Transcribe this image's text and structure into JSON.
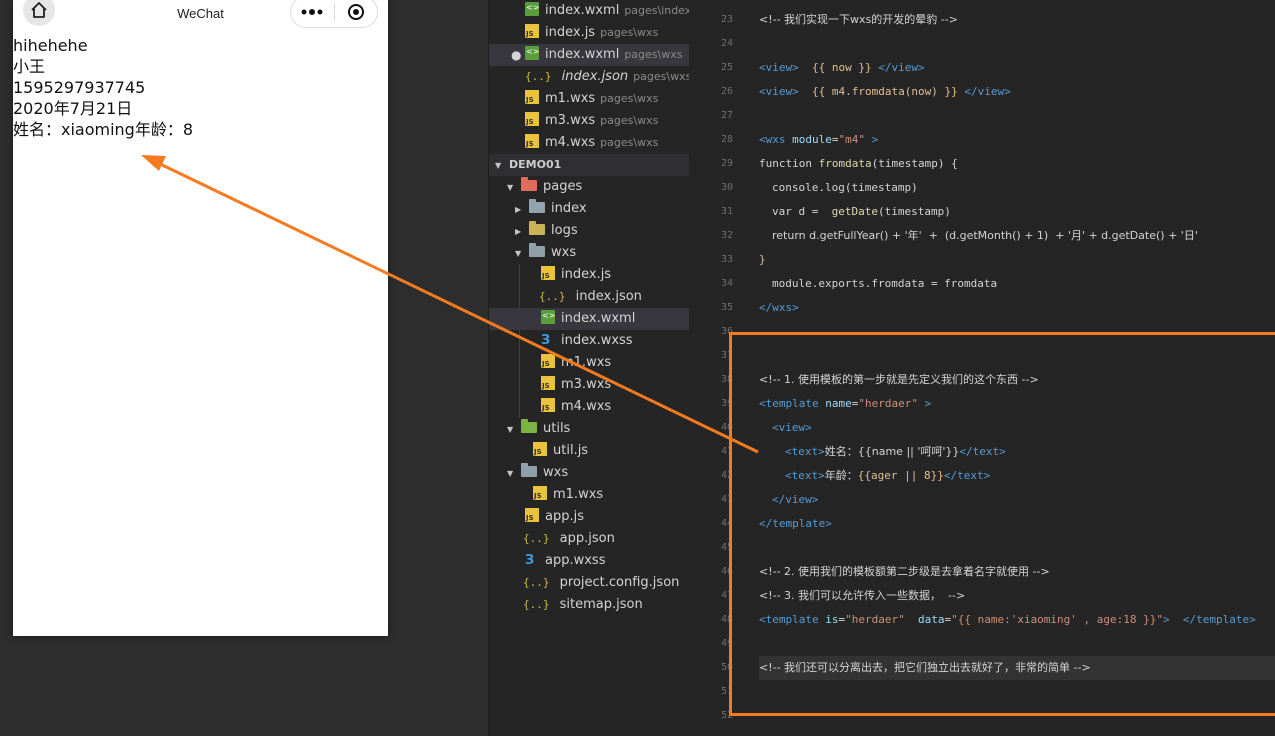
{
  "simulator": {
    "title": "WeChat",
    "lines": [
      "hihehehe",
      "小王",
      "1595297937745",
      "2020年7月21日",
      "姓名：xiaoming年龄：8"
    ]
  },
  "explorer": {
    "open_editors": [
      {
        "name": "index.wxml",
        "path": "pages\\index",
        "icon": "wxml"
      },
      {
        "name": "index.js",
        "path": "pages\\wxs",
        "icon": "js"
      },
      {
        "name": "index.wxml",
        "path": "pages\\wxs",
        "icon": "wxml",
        "modified": true
      },
      {
        "name": "index.json",
        "path": "pages\\wxs",
        "icon": "json",
        "italic": true
      },
      {
        "name": "m1.wxs",
        "path": "pages\\wxs",
        "icon": "js"
      },
      {
        "name": "m3.wxs",
        "path": "pages\\wxs",
        "icon": "js"
      },
      {
        "name": "m4.wxs",
        "path": "pages\\wxs",
        "icon": "js"
      }
    ],
    "project": "DEMO01",
    "tree": {
      "pages": "pages",
      "index": "index",
      "logs": "logs",
      "wxs": "wxs",
      "wxs_files": [
        "index.js",
        "index.json",
        "index.wxml",
        "index.wxss",
        "m1.wxs",
        "m3.wxs",
        "m4.wxs"
      ],
      "utils": "utils",
      "util_js": "util.js",
      "wxs2": "wxs",
      "m1": "m1.wxs",
      "root_files": [
        "app.js",
        "app.json",
        "app.wxss",
        "project.config.json",
        "sitemap.json"
      ]
    }
  },
  "editor": {
    "line_numbers": [
      "23",
      "24",
      "25",
      "26",
      "27",
      "28",
      "29",
      "30",
      "31",
      "32",
      "33",
      "34",
      "35",
      "36",
      "37",
      "38",
      "39",
      "40",
      "41",
      "42",
      "43",
      "44",
      "45",
      "46",
      "47",
      "48",
      "49",
      "50",
      "51",
      "52"
    ],
    "l23": "<!-- 我们实现一下wxs的开发的晕豹 -->",
    "l25a": "<view>",
    "l25b": "{{ now }}",
    "l25c": "</view>",
    "l26a": "<view>",
    "l26b": "{{ m4.fromdata(now) }}",
    "l26c": "</view>",
    "l28a": "<wxs",
    "l28b": "module",
    "l28c": "\"m4\"",
    "l28d": ">",
    "l29a": "function",
    "l29b": "fromdata",
    "l29c": "(timestamp) {",
    "l30": "console.log(timestamp)",
    "l31a": "var",
    "l31b": "d =",
    "l31c": "getDate",
    "l31d": "(timestamp)",
    "l32": "return d.getFullYear() + '年'  +  (d.getMonth() + 1)  + '月' + d.getDate() + '日'",
    "l33": "}",
    "l34": "module.exports.fromdata = fromdata",
    "l35": "</wxs>",
    "l38": "<!-- 1. 使用模板的第一步就是先定义我们的这个东西 -->",
    "l39a": "<template",
    "l39b": "name",
    "l39c": "\"herdaer\"",
    "l39d": ">",
    "l40": "<view>",
    "l41a": "<text>",
    "l41b": "姓名：",
    "l41c": "{{name || '呵呵'}}",
    "l41d": "</text>",
    "l42a": "<text>",
    "l42b": "年龄：",
    "l42c": "{{ager || 8}}",
    "l42d": "</text>",
    "l43": "</view>",
    "l44": "</template>",
    "l47": "<!-- 2. 使用我们的模板额第二步级是去拿着名字就使用 -->",
    "l48": "<!-- 3. 我们可以允许传入一些数据，  -->",
    "l49a": "<template",
    "l49b": "is",
    "l49c": "\"herdaer\"",
    "l49d": "data",
    "l49e": "\"{{ name:'xiaoming' , age:18 }}\"",
    "l49f": ">",
    "l49g": "</template>",
    "l51": "<!-- 我们还可以分离出去，把它们独立出去就好了，非常的简单 -->"
  },
  "colors": {
    "annotation": "#f47b20",
    "editor_bg": "#252526",
    "comment": "#6a9955",
    "tag": "#569cd6"
  }
}
